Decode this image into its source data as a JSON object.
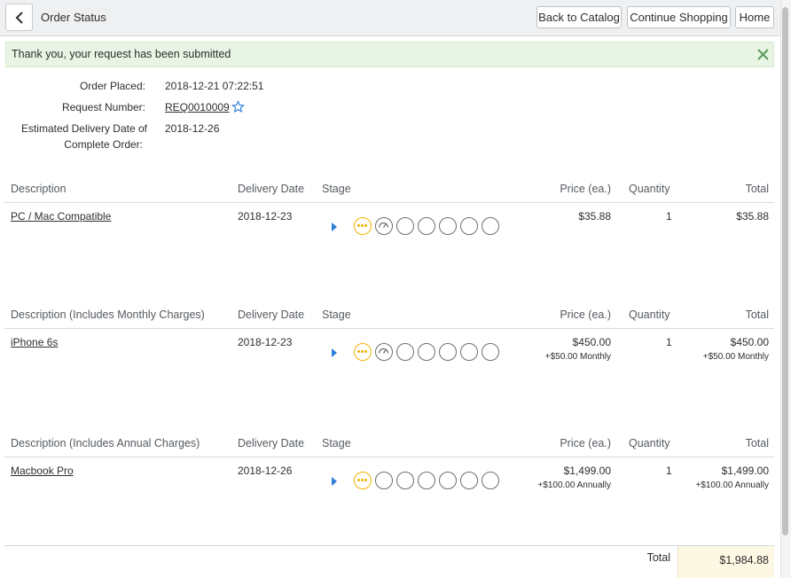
{
  "header": {
    "title": "Order Status",
    "back_to_catalog": "Back to Catalog",
    "continue_shopping": "Continue Shopping",
    "home": "Home"
  },
  "alert": {
    "message": "Thank you, your request has been submitted"
  },
  "order": {
    "placed_label": "Order Placed:",
    "placed_value": "2018-12-21 07:22:51",
    "request_label": "Request Number:",
    "request_value": "REQ0010009",
    "delivery_label_1": "Estimated Delivery Date of",
    "delivery_label_2": "Complete Order:",
    "delivery_value": "2018-12-26"
  },
  "columns": {
    "delivery_date": "Delivery Date",
    "stage": "Stage",
    "price": "Price (ea.)",
    "quantity": "Quantity",
    "total": "Total"
  },
  "sections": [
    {
      "description_header": "Description",
      "item": "PC / Mac Compatible",
      "delivery_date": "2018-12-23",
      "price": "$35.88",
      "price_sub": "",
      "quantity": "1",
      "total": "$35.88",
      "total_sub": ""
    },
    {
      "description_header": "Description (Includes Monthly Charges)",
      "item": "iPhone 6s",
      "delivery_date": "2018-12-23",
      "price": "$450.00",
      "price_sub": "+$50.00 Monthly",
      "quantity": "1",
      "total": "$450.00",
      "total_sub": "+$50.00 Monthly"
    },
    {
      "description_header": "Description (Includes Annual Charges)",
      "item": "Macbook Pro",
      "delivery_date": "2018-12-26",
      "price": "$1,499.00",
      "price_sub": "+$100.00 Annually",
      "quantity": "1",
      "total": "$1,499.00",
      "total_sub": "+$100.00 Annually"
    }
  ],
  "summary": {
    "total_label": "Total",
    "total_value": "$1,984.88"
  },
  "colors": {
    "alert_bg": "#e8f5e4",
    "stage_active": "#f1b300",
    "stage_arrow": "#2e7fd6",
    "total_bg": "#fcf8e3"
  }
}
